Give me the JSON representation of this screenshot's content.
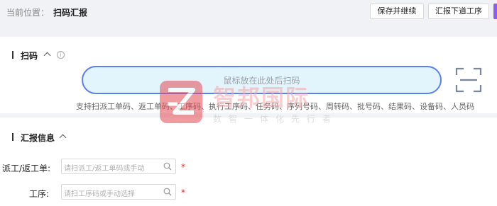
{
  "breadcrumb": {
    "prefix": "当前位置：",
    "current": "扫码汇报"
  },
  "toolbar": {
    "save_continue_label": "保存并继续",
    "report_next_label": "汇报下道工序"
  },
  "scan_section": {
    "title": "扫码",
    "placeholder": "鼠标放在此处后扫码",
    "hint": "支持扫派工单码、返工单码、工序码、执行工序码、任务码、序列号码、周转码、批号码、结果码、设备码、人员码",
    "scan_icon": "scan-icon"
  },
  "report_section": {
    "title": "汇报信息",
    "fields": [
      {
        "label": "派工/返工单:",
        "placeholder": "请扫派工/返工单码或手动",
        "required_mark": "*"
      },
      {
        "label": "工序:",
        "placeholder": "请扫工序码或手动选择",
        "required_mark": "*"
      }
    ]
  },
  "watermark": {
    "name": "智邦国际",
    "slogan": "数智一体化先行者"
  },
  "colors": {
    "scan_border": "#5b7ff0",
    "scan_fill": "#e2f5fc",
    "required": "#f5222d",
    "watermark_red": "#e24a54"
  }
}
